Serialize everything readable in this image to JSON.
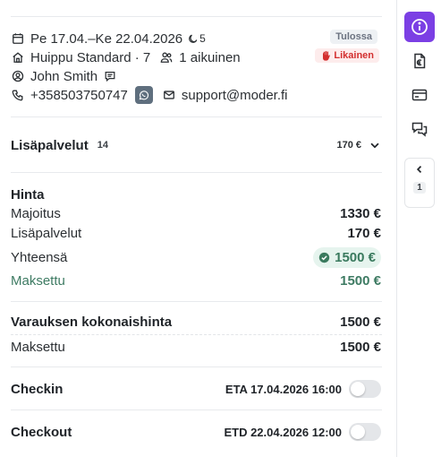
{
  "booking": {
    "dates": "Pe 17.04.–Ke 22.04.2026",
    "nights": "5",
    "status": "Tulossa",
    "room": "Huippu Standard · 7",
    "guests": "1 aikuinen",
    "cleaning": "Likainen",
    "guest_name": "John Smith",
    "phone": "+358503750747",
    "email": "support@moder.fi"
  },
  "services": {
    "title": "Lisäpalvelut",
    "count": "14",
    "amount": "170 €"
  },
  "price": {
    "title": "Hinta",
    "rows": [
      {
        "label": "Majoitus",
        "value": "1330 €"
      },
      {
        "label": "Lisäpalvelut",
        "value": "170 €"
      }
    ],
    "total_label": "Yhteensä",
    "total_value": "1500 €",
    "paid_label": "Maksettu",
    "paid_value": "1500 €"
  },
  "booking_total": {
    "label": "Varauksen kokonaishinta",
    "value": "1500 €",
    "paid_label": "Maksettu",
    "paid_value": "1500 €"
  },
  "checkin": {
    "label": "Checkin",
    "time": "ETA 17.04.2026 16:00"
  },
  "checkout": {
    "label": "Checkout",
    "time": "ETD 22.04.2026 12:00"
  },
  "rail": {
    "collapse_count": "1"
  },
  "colors": {
    "accent": "#7b3fe4",
    "paid_green": "#3e7b63",
    "dirty_red": "#d32f2f"
  }
}
